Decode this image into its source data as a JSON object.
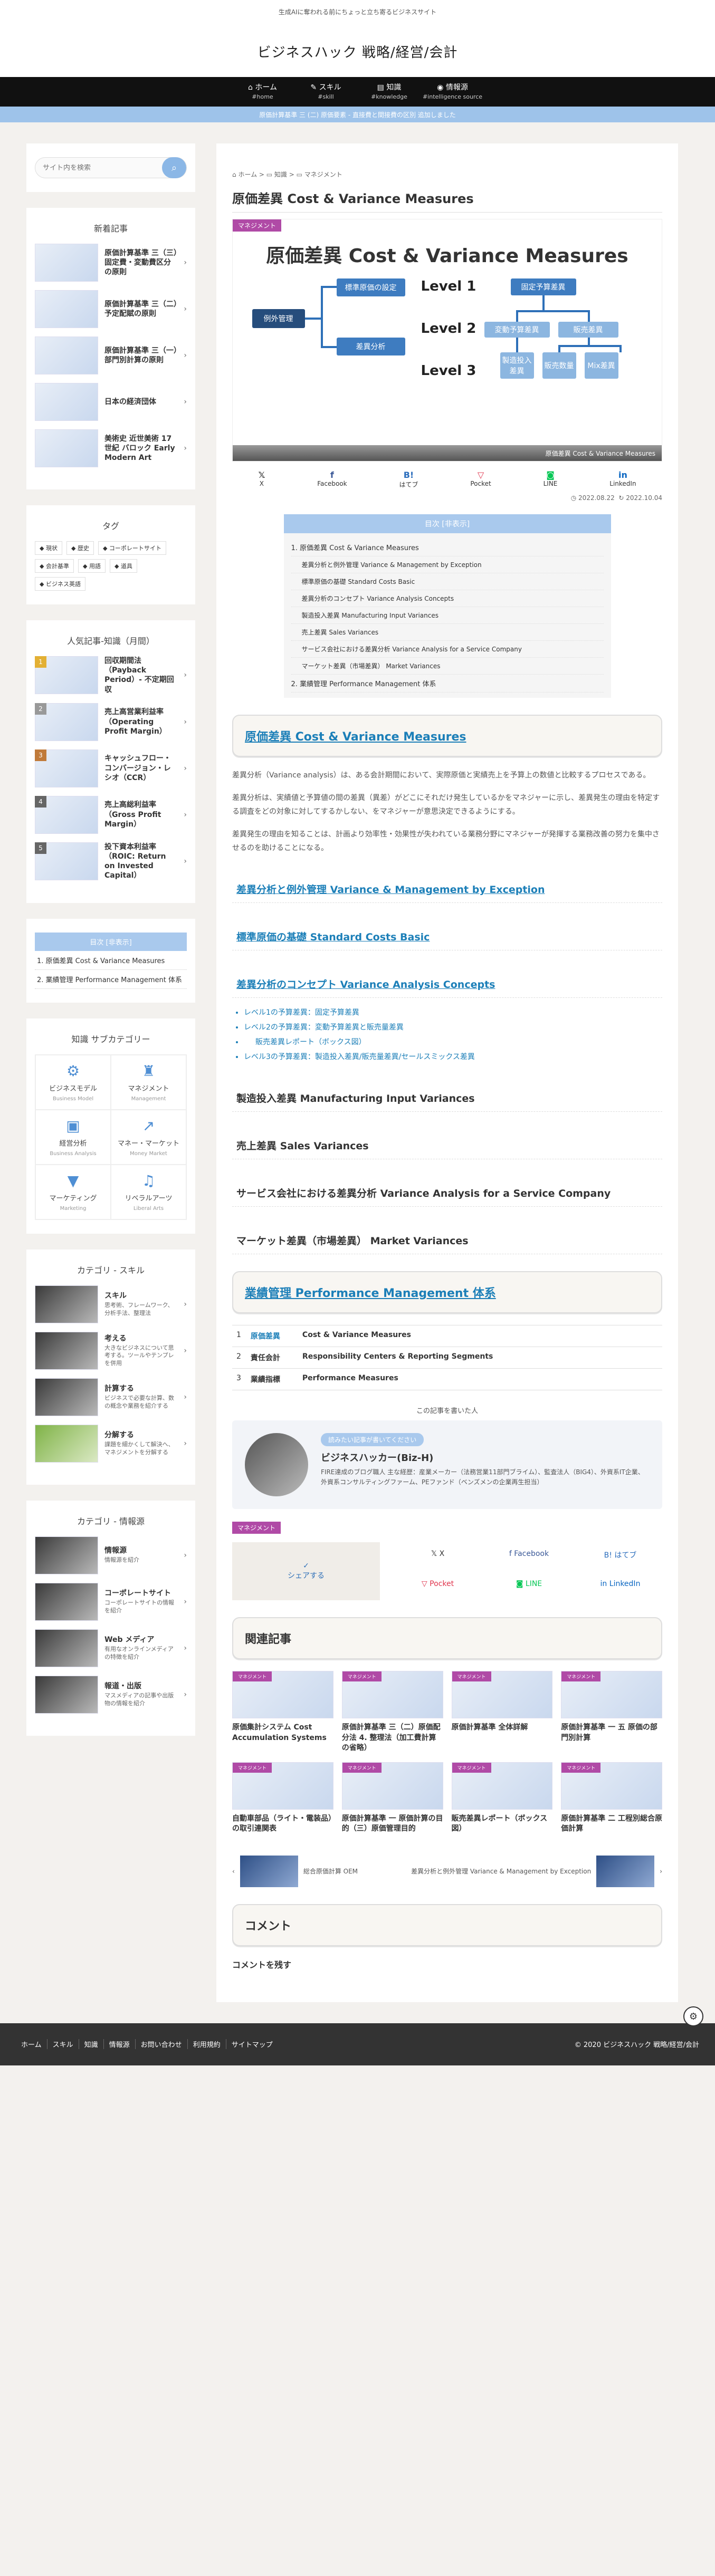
{
  "header": {
    "tagline": "生成AIに奪われる前にちょっと立ち寄るビジネスサイト",
    "site_title": "ビジネスハック 戦略/経営/会計"
  },
  "gnav": [
    {
      "icon": "home-icon",
      "label": "ホーム",
      "sub": "#home"
    },
    {
      "icon": "skill-icon",
      "label": "スキル",
      "sub": "#skill"
    },
    {
      "icon": "knowledge-icon",
      "label": "知識",
      "sub": "#knowledge"
    },
    {
      "icon": "source-icon",
      "label": "情報源",
      "sub": "#intelligence source"
    }
  ],
  "notice": "原価計算基準 三 (二) 原価要素 - 直接費と間接費の区別 追加しました",
  "search": {
    "placeholder": "サイト内を検索"
  },
  "sidebar": {
    "new_title": "新着記事",
    "new_posts": [
      {
        "title": "原価計算基準 三（三）固定費・変動費区分の原則"
      },
      {
        "title": "原価計算基準 三（二）予定配賦の原則"
      },
      {
        "title": "原価計算基準 三（一）部門別計算の原則"
      },
      {
        "title": "日本の経済団体"
      },
      {
        "title": "美術史 近世美術 17世紀 バロック Early Modern Art"
      }
    ],
    "tag_title": "タグ",
    "tags": [
      "現状",
      "歴史",
      "コーポレートサイト",
      "会計基準",
      "用語",
      "道具",
      "ビジネス英語"
    ],
    "rank_title": "人気記事-知識（月間）",
    "ranking": [
      {
        "rank": "1",
        "color": "#e3b034",
        "title": "回収期間法（Payback Period）- 不定期回収"
      },
      {
        "rank": "2",
        "color": "#999999",
        "title": "売上高営業利益率（Operating Profit Margin）"
      },
      {
        "rank": "3",
        "color": "#c07a3a",
        "title": "キャッシュフロー・コンバージョン・レシオ（CCR）"
      },
      {
        "rank": "4",
        "color": "#666666",
        "title": "売上高総利益率（Gross Profit Margin）"
      },
      {
        "rank": "5",
        "color": "#666666",
        "title": "投下資本利益率（ROIC: Return on Invested Capital）"
      }
    ],
    "toc_title": "目次 [非表示]",
    "toc_items": [
      "1. 原価差異 Cost & Variance Measures",
      "2. 業績管理 Performance Management 体系"
    ],
    "sub_cat_title": "知識 サブカテゴリー",
    "sub_cats": [
      {
        "icon": "business-model-icon",
        "name": "ビジネスモデル",
        "en": "Business Model"
      },
      {
        "icon": "management-icon",
        "name": "マネジメント",
        "en": "Management"
      },
      {
        "icon": "accounting-icon",
        "name": "経営分析",
        "en": "Business Analysis"
      },
      {
        "icon": "money-market-icon",
        "name": "マネー・マーケット",
        "en": "Money Market"
      },
      {
        "icon": "marketing-icon",
        "name": "マーケティング",
        "en": "Marketing"
      },
      {
        "icon": "liberal-arts-icon",
        "name": "リベラルアーツ",
        "en": "Liberal Arts"
      }
    ],
    "skill_title": "カテゴリ - スキル",
    "skills": [
      {
        "title": "スキル",
        "desc": "思考術、フレームワーク、分析手法、整理法"
      },
      {
        "title": "考える",
        "desc": "大きなビジネスについて思考する。ツールやテンプレを併用"
      },
      {
        "title": "計算する",
        "desc": "ビジネスで必要な計算、数の概念や業務を紹介する"
      },
      {
        "title": "分解する",
        "desc": "課題を細かくして解決へ、マネジメントを分解する"
      }
    ],
    "source_title": "カテゴリ - 情報源",
    "sources": [
      {
        "title": "情報源",
        "desc": "情報源を紹介"
      },
      {
        "title": "コーポレートサイト",
        "desc": "コーポレートサイトの情報を紹介"
      },
      {
        "title": "Web メディア",
        "desc": "有用なオンラインメディアの特徴を紹介"
      },
      {
        "title": "報道・出版",
        "desc": "マスメディアの記事や出版物の情報を紹介"
      }
    ]
  },
  "article": {
    "breadcrumb": [
      "ホーム",
      "知識",
      "マネジメント"
    ],
    "title": "原価差異 Cost & Variance Measures",
    "category": "マネジメント",
    "eyecatch": {
      "title": "原価差異 Cost & Variance Measures",
      "root": "例外管理",
      "std": "標準原価の設定",
      "var": "差異分析",
      "l1": "Level 1",
      "l2": "Level 2",
      "l3": "Level 3",
      "fixed": "固定予算差異",
      "flex": "変動予算差異",
      "salesvol": "販売差異",
      "mfg": "製造投入差異",
      "sales": "販売数量",
      "mix": "Mix差異",
      "caption": "原価差異 Cost & Variance Measures"
    },
    "share_top": [
      {
        "icon": "x-icon",
        "label": "X"
      },
      {
        "icon": "facebook-icon",
        "label": "Facebook"
      },
      {
        "icon": "hatena-icon",
        "label": "はてブ"
      },
      {
        "icon": "pocket-icon",
        "label": "Pocket"
      },
      {
        "icon": "line-icon",
        "label": "LINE"
      },
      {
        "icon": "linkedin-icon",
        "label": "LinkedIn"
      }
    ],
    "published": "2022.08.22",
    "updated": "2022.10.04",
    "toc": {
      "title": "目次 [非表示]",
      "items": [
        {
          "text": "1. 原価差異 Cost & Variance Measures",
          "sub": false
        },
        {
          "text": "差異分析と例外管理 Variance & Management by Exception",
          "sub": true
        },
        {
          "text": "標準原価の基礎 Standard Costs Basic",
          "sub": true
        },
        {
          "text": "差異分析のコンセプト Variance Analysis Concepts",
          "sub": true
        },
        {
          "text": "製造投入差異 Manufacturing Input Variances",
          "sub": true
        },
        {
          "text": "売上差異 Sales Variances",
          "sub": true
        },
        {
          "text": "サービス会社における差異分析 Variance Analysis for a Service Company",
          "sub": true
        },
        {
          "text": "マーケット差異（市場差異） Market Variances",
          "sub": true
        },
        {
          "text": "2. 業績管理 Performance Management 体系",
          "sub": false
        }
      ]
    },
    "h2_1": "原価差異 Cost & Variance Measures",
    "p1": "差異分析（Variance analysis）は、ある会計期間において、実際原価と実績売上を予算上の数値と比較するプロセスである。",
    "p2": "差異分析は、実績値と予算値の間の差異（異差）がどこにそれだけ発生しているかをマネジャーに示し、差異発生の理由を特定する調査をどの対象に対してするかしない、をマネジャーが意思決定できるようにする。",
    "p3": "差異発生の理由を知ることは、計画より効率性・効果性が失われている業務分野にマネジャーが発揮する業務改善の努力を集中させるのを助けることになる。",
    "h3_1": "差異分析と例外管理 Variance & Management by Exception",
    "h3_2": "標準原価の基礎 Standard Costs Basic",
    "h3_3": "差異分析のコンセプト Variance Analysis Concepts",
    "concept_list": [
      {
        "text": "レベル1の予算差異：固定予算差異",
        "sub": false
      },
      {
        "text": "レベル2の予算差異：変動予算差異と販売量差異",
        "sub": false
      },
      {
        "text": "販売差異レポート（ボックス図）",
        "sub": true
      },
      {
        "text": "レベル3の予算差異：製造投入差異/販売量差異/セールスミックス差異",
        "sub": false
      }
    ],
    "h3_4": "製造投入差異 Manufacturing Input Variances",
    "h3_5": "売上差異 Sales Variances",
    "h3_6": "サービス会社における差異分析 Variance Analysis for a Service Company",
    "h3_7": "マーケット差異（市場差異） Market Variances",
    "h2_2": "業績管理 Performance Management 体系",
    "perf_table": [
      {
        "num": "1",
        "cat": "原価差異",
        "text": "Cost & Variance Measures",
        "link": true
      },
      {
        "num": "2",
        "cat": "責任会計",
        "text": "Responsibility Centers & Reporting Segments",
        "link": false
      },
      {
        "num": "3",
        "cat": "業績指標",
        "text": "Performance Measures",
        "link": false
      }
    ],
    "author_header": "この記事を書いた人",
    "author_badge": "読みたい記事が書いてください",
    "author_name": "ビジネスハッカー(Biz-H)",
    "author_desc": "FIRE達成のブログ職人 主な経歴：産業メーカー（法務営業11部門ブライム）、監査法人（BIG4）、外資系IT企業、外資系コンサルティングファーム、PEファンド（ベンズメンの企業再生担当）",
    "share_label": "シェアする",
    "share_bottom": [
      {
        "icon": "x-icon",
        "label": "X"
      },
      {
        "icon": "facebook-icon",
        "label": "Facebook"
      },
      {
        "icon": "hatena-icon",
        "label": "はてブ"
      },
      {
        "icon": "pocket-icon",
        "label": "Pocket"
      },
      {
        "icon": "line-icon",
        "label": "LINE"
      },
      {
        "icon": "linkedin-icon",
        "label": "LinkedIn"
      }
    ],
    "related_title": "関連記事",
    "related": [
      {
        "title": "原価集計システム Cost Accumulation Systems"
      },
      {
        "title": "原価計算基準 三（二）原価配分法 4. 整理法（加工費計算の省略）"
      },
      {
        "title": "原価計算基準 全体詳解"
      },
      {
        "title": "原価計算基準 一 五 原価の部門別計算"
      },
      {
        "title": "自動車部品（ライト・電装品）の取引連関表"
      },
      {
        "title": "原価計算基準 一 原価計算の目的（三）原価管理目的"
      },
      {
        "title": "販売差異レポート（ボックス図）"
      },
      {
        "title": "原価計算基準 二 工程別総合原価計算"
      }
    ],
    "prev": "総合原価計算 OEM",
    "next": "差異分析と例外管理 Variance & Management by Exception",
    "comment_title": "コメント",
    "comment_label": "コメントを残す"
  },
  "footer": {
    "nav": [
      "ホーム",
      "スキル",
      "知識",
      "情報源",
      "お問い合わせ",
      "利用規約",
      "サイトマップ"
    ],
    "copyright": "© 2020 ビジネスハック 戦略/経営/会計"
  }
}
